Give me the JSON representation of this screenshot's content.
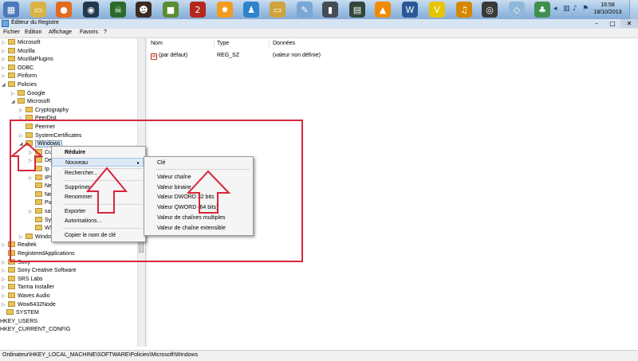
{
  "taskbar": {
    "icons": [
      {
        "name": "windows-explorer-icon",
        "color": "#4a78b8",
        "glyph": "▦"
      },
      {
        "name": "folder-icon",
        "color": "#d9b445",
        "glyph": "▭"
      },
      {
        "name": "firefox-icon",
        "color": "#e46a1e",
        "glyph": "●"
      },
      {
        "name": "steam-icon",
        "color": "#23374e",
        "glyph": "◉"
      },
      {
        "name": "skull-game-icon",
        "color": "#2a6b2a",
        "glyph": "☠"
      },
      {
        "name": "character-game-icon",
        "color": "#3b2a22",
        "glyph": "☻"
      },
      {
        "name": "minecraft-icon",
        "color": "#5b8c32",
        "glyph": "■"
      },
      {
        "name": "game-2-icon",
        "color": "#b3271e",
        "glyph": "2"
      },
      {
        "name": "avast-icon",
        "color": "#f29b1c",
        "glyph": "✹"
      },
      {
        "name": "messenger-icon",
        "color": "#2f83c9",
        "glyph": "♟"
      },
      {
        "name": "pictures-folder-icon",
        "color": "#d1a33c",
        "glyph": "▭"
      },
      {
        "name": "paint-icon",
        "color": "#7aa7d6",
        "glyph": "✎"
      },
      {
        "name": "phone-tool-icon",
        "color": "#444b55",
        "glyph": "▮"
      },
      {
        "name": "network-meter-icon",
        "color": "#31473a",
        "glyph": "▤"
      },
      {
        "name": "vlc-icon",
        "color": "#f08a00",
        "glyph": "▲"
      },
      {
        "name": "word-icon",
        "color": "#2b5797",
        "glyph": "W"
      },
      {
        "name": "v-app-icon",
        "color": "#e7c400",
        "glyph": "V"
      },
      {
        "name": "headset-icon",
        "color": "#d68700",
        "glyph": "♫"
      },
      {
        "name": "disc-tool-icon",
        "color": "#3a3a3a",
        "glyph": "◎"
      },
      {
        "name": "virtual-drive-icon",
        "color": "#8fb7d9",
        "glyph": "◇"
      },
      {
        "name": "spider-solitaire-icon",
        "color": "#3f8f4f",
        "glyph": "♣"
      }
    ],
    "clock_time": "16:58",
    "clock_date": "18/10/2013"
  },
  "window": {
    "title": "Éditeur du Registre"
  },
  "menubar": {
    "items": [
      "Fichier",
      "Edition",
      "Affichage",
      "Favoris",
      "?"
    ]
  },
  "tree": {
    "items": [
      {
        "label": "Microsoft",
        "level": 0,
        "arrow": "▷",
        "folder": true
      },
      {
        "label": "Mozilla",
        "level": 0,
        "arrow": "▷",
        "folder": true
      },
      {
        "label": "MozillaPlugins",
        "level": 0,
        "arrow": "▷",
        "folder": true
      },
      {
        "label": "ODBC",
        "level": 0,
        "arrow": "▷",
        "folder": true
      },
      {
        "label": "Piriform",
        "level": 0,
        "arrow": "▷",
        "folder": true
      },
      {
        "label": "Policies",
        "level": 0,
        "arrow": "◢",
        "folder": true
      },
      {
        "label": "Google",
        "level": 1,
        "arrow": "▷",
        "folder": true
      },
      {
        "label": "Microsoft",
        "level": 1,
        "arrow": "◢",
        "folder": true
      },
      {
        "label": "Cryptography",
        "level": 2,
        "arrow": "▷",
        "folder": true
      },
      {
        "label": "PeerDist",
        "level": 2,
        "arrow": "▷",
        "folder": true
      },
      {
        "label": "Peernet",
        "level": 2,
        "arrow": "",
        "folder": true
      },
      {
        "label": "SystemCertificates",
        "level": 2,
        "arrow": "▷",
        "folder": true
      },
      {
        "label": "Windows",
        "level": 2,
        "arrow": "◢",
        "folder": true,
        "selected": true
      },
      {
        "label": "Cu",
        "level": 3,
        "arrow": "▷",
        "folder": true
      },
      {
        "label": "De",
        "level": 3,
        "arrow": "▷",
        "folder": true
      },
      {
        "label": "Ip",
        "level": 3,
        "arrow": "",
        "folder": true
      },
      {
        "label": "IPS",
        "level": 3,
        "arrow": "▷",
        "folder": true
      },
      {
        "label": "Ne",
        "level": 3,
        "arrow": "",
        "folder": true
      },
      {
        "label": "Ne",
        "level": 3,
        "arrow": "",
        "folder": true
      },
      {
        "label": "Pu",
        "level": 3,
        "arrow": "",
        "folder": true
      },
      {
        "label": "saf",
        "level": 3,
        "arrow": "▷",
        "folder": true
      },
      {
        "label": "Sy",
        "level": 3,
        "arrow": "",
        "folder": true
      },
      {
        "label": "WS",
        "level": 3,
        "arrow": "",
        "folder": true
      },
      {
        "label": "Windo",
        "level": 2,
        "arrow": "▷",
        "folder": true
      },
      {
        "label": "Realtek",
        "level": 0,
        "arrow": "▷",
        "folder": true
      },
      {
        "label": "RegisteredApplications",
        "level": 0,
        "arrow": "",
        "folder": true
      },
      {
        "label": "Sony",
        "level": 0,
        "arrow": "▷",
        "folder": true
      },
      {
        "label": "Sony Creative Software",
        "level": 0,
        "arrow": "▷",
        "folder": true
      },
      {
        "label": "SRS Labs",
        "level": 0,
        "arrow": "▷",
        "folder": true
      },
      {
        "label": "Tarma Installer",
        "level": 0,
        "arrow": "▷",
        "folder": true
      },
      {
        "label": "Waves Audio",
        "level": 0,
        "arrow": "▷",
        "folder": true
      },
      {
        "label": "Wow6432Node",
        "level": 0,
        "arrow": "▷",
        "folder": true
      },
      {
        "label": "SYSTEM",
        "level": -1,
        "arrow": "",
        "folder": true
      },
      {
        "label": "HKEY_USERS",
        "level": -2,
        "arrow": "",
        "folder": false
      },
      {
        "label": "HKEY_CURRENT_CONFIG",
        "level": -2,
        "arrow": "",
        "folder": false
      }
    ]
  },
  "list": {
    "headers": {
      "name": "Nom",
      "type": "Type",
      "data": "Données"
    },
    "rows": [
      {
        "icon": "ab",
        "name": "(par défaut)",
        "type": "REG_SZ",
        "data": "(valeur non définie)"
      }
    ]
  },
  "context_menu": {
    "items": [
      "Réduire",
      "Nouveau",
      "Rechercher...",
      "Supprimer",
      "Renommer",
      "Exporter",
      "Autorisations...",
      "Copier le nom de clé"
    ],
    "submenu_arrow": "▸"
  },
  "submenu": {
    "items": [
      "Clé",
      "Valeur chaîne",
      "Valeur binaire",
      "Valeur DWORD 32 bits",
      "Valeur QWORD (64 bits)",
      "Valeur de chaînes multiples",
      "Valeur de chaîne extensible"
    ]
  },
  "status": {
    "path": "Ordinateur\\HKEY_LOCAL_MACHINE\\SOFTWARE\\Policies\\Microsoft\\Windows"
  },
  "colors": {
    "annotation_red": "#d7263d",
    "highlight": "#dce8f6",
    "selection": "#cce4f7"
  }
}
